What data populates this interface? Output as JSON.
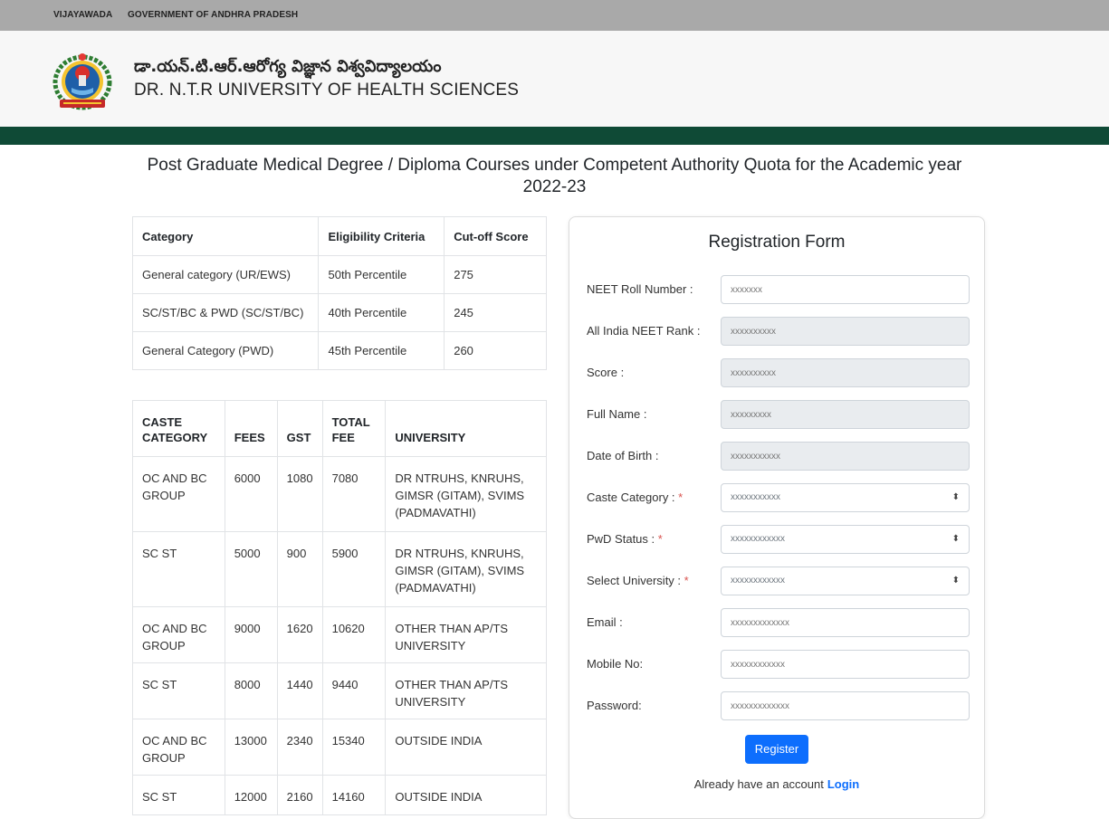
{
  "topbar": {
    "city": "VIJAYAWADA",
    "government": "GOVERNMENT OF ANDHRA PRADESH"
  },
  "header": {
    "title_telugu": "డా.యన్.టి.ఆర్.ఆరోగ్య విజ్ఞాన విశ్వవిద్యాలయం",
    "title_english": "DR. N.T.R UNIVERSITY OF HEALTH SCIENCES",
    "logo_icon": "university-seal-icon"
  },
  "colors": {
    "topbar": "#a9a9a9",
    "green_band": "#0f4a36",
    "primary": "#0d6efd",
    "required": "#d9534f"
  },
  "page_heading": "Post Graduate Medical Degree / Diploma Courses under Competent Authority Quota for the Academic year 2022-23",
  "eligibility_table": {
    "headers": [
      "Category",
      "Eligibility Criteria",
      "Cut-off Score"
    ],
    "rows": [
      [
        "General category (UR/EWS)",
        "50th Percentile",
        "275"
      ],
      [
        "SC/ST/BC & PWD (SC/ST/BC)",
        "40th Percentile",
        "245"
      ],
      [
        "General Category (PWD)",
        "45th Percentile",
        "260"
      ]
    ]
  },
  "fee_table": {
    "headers": [
      "CASTE CATEGORY",
      "FEES",
      "GST",
      "TOTAL FEE",
      "UNIVERSITY"
    ],
    "rows": [
      [
        "OC AND BC GROUP",
        "6000",
        "1080",
        "7080",
        "DR NTRUHS, KNRUHS, GIMSR (GITAM), SVIMS (PADMAVATHI)"
      ],
      [
        "SC ST",
        "5000",
        "900",
        "5900",
        "DR NTRUHS, KNRUHS, GIMSR (GITAM), SVIMS (PADMAVATHI)"
      ],
      [
        "OC AND BC GROUP",
        "9000",
        "1620",
        "10620",
        "OTHER THAN AP/TS UNIVERSITY"
      ],
      [
        "SC ST",
        "8000",
        "1440",
        "9440",
        "OTHER THAN AP/TS UNIVERSITY"
      ],
      [
        "OC AND BC GROUP",
        "13000",
        "2340",
        "15340",
        "OUTSIDE INDIA"
      ],
      [
        "SC ST",
        "12000",
        "2160",
        "14160",
        "OUTSIDE INDIA"
      ]
    ]
  },
  "form": {
    "title": "Registration Form",
    "fields": [
      {
        "label": "NEET Roll Number :",
        "placeholder": "xxxxxxx"
      },
      {
        "label": "All India NEET Rank :",
        "placeholder": "xxxxxxxxxx"
      },
      {
        "label": "Score :",
        "placeholder": "xxxxxxxxxx"
      },
      {
        "label": "Full Name :",
        "placeholder": "xxxxxxxxx"
      },
      {
        "label": "Date of Birth :",
        "placeholder": "xxxxxxxxxxx"
      },
      {
        "label": "Caste Category :",
        "required_mark": "*",
        "value": "xxxxxxxxxxx"
      },
      {
        "label": "PwD Status :",
        "required_mark": "*",
        "value": "xxxxxxxxxxxx"
      },
      {
        "label": "Select University :",
        "required_mark": "*",
        "value": "xxxxxxxxxxxx"
      },
      {
        "label": "Email :",
        "placeholder": "xxxxxxxxxxxxx"
      },
      {
        "label": "Mobile No:",
        "placeholder": "xxxxxxxxxxxx"
      },
      {
        "label": "Password:",
        "placeholder": "xxxxxxxxxxxxx"
      }
    ],
    "register_label": "Register",
    "login_prompt": "Already have an account",
    "login_label": "Login"
  }
}
